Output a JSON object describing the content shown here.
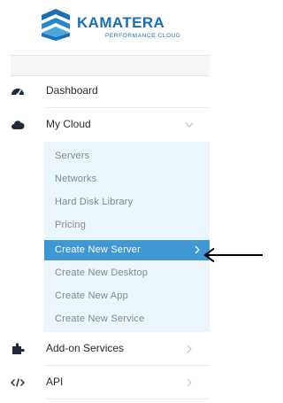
{
  "brand": {
    "name": "KAMATERA",
    "tagline": "PERFORMANCE CLOUD",
    "color": "#1b6fb3"
  },
  "nav": {
    "items": [
      {
        "label": "Dashboard",
        "icon": "dashboard-icon",
        "expandable": false
      },
      {
        "label": "My Cloud",
        "icon": "cloud-icon",
        "expandable": true,
        "expanded": true
      },
      {
        "label": "Add-on Services",
        "icon": "puzzle-icon",
        "expandable": true,
        "expanded": false
      },
      {
        "label": "API",
        "icon": "code-icon",
        "expandable": true,
        "expanded": false
      }
    ]
  },
  "my_cloud_submenu": {
    "items": [
      {
        "label": "Servers",
        "active": false
      },
      {
        "label": "Networks",
        "active": false
      },
      {
        "label": "Hard Disk Library",
        "active": false
      },
      {
        "label": "Pricing",
        "active": false
      },
      {
        "label": "Create New Server",
        "active": true
      },
      {
        "label": "Create New Desktop",
        "active": false
      },
      {
        "label": "Create New App",
        "active": false
      },
      {
        "label": "Create New Service",
        "active": false
      }
    ]
  },
  "colors": {
    "active_background": "#3f97d4",
    "submenu_background": "#eaf6fc"
  }
}
